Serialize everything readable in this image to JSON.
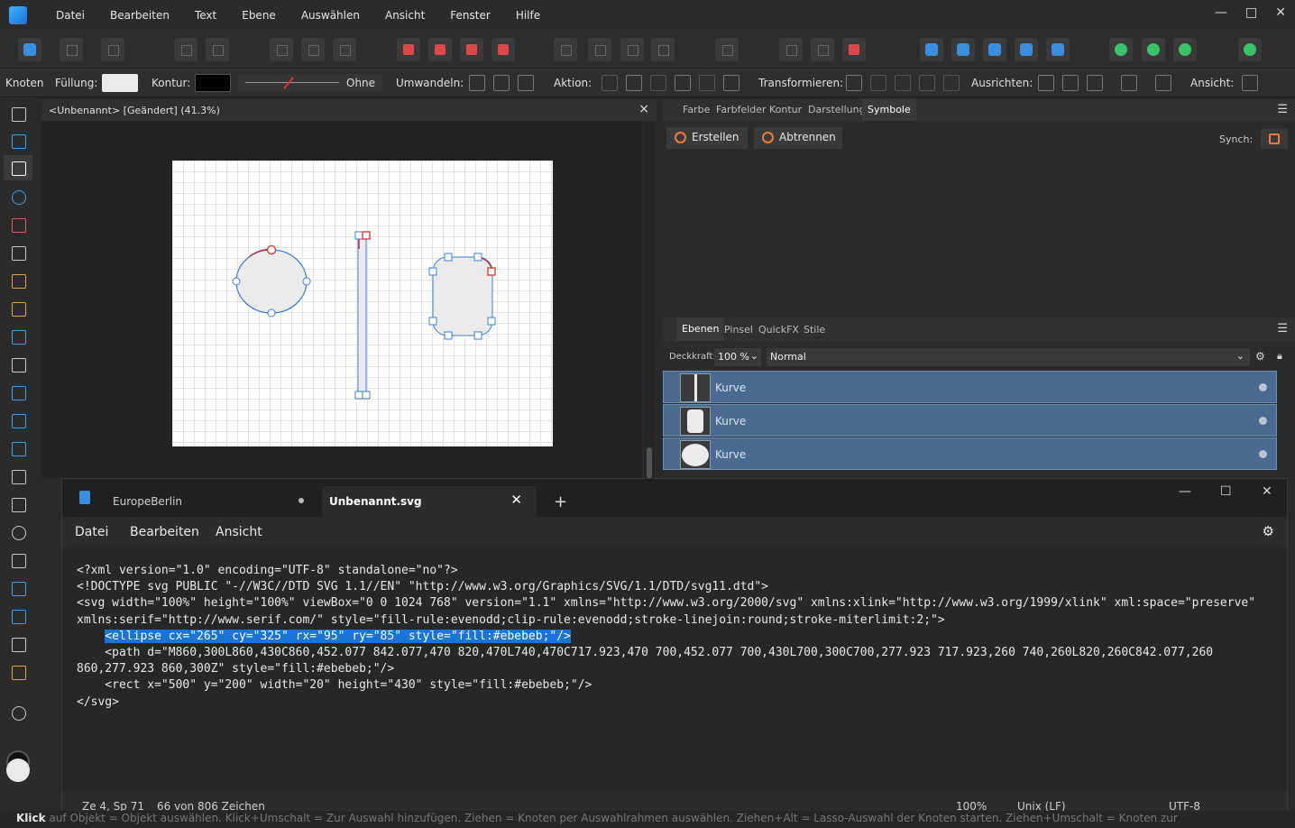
{
  "menubar": {
    "items": [
      "Datei",
      "Bearbeiten",
      "Text",
      "Ebene",
      "Auswählen",
      "Ansicht",
      "Fenster",
      "Hilfe"
    ],
    "window_controls": [
      "—",
      "□",
      "✕"
    ]
  },
  "context_bar": {
    "mode": "Knoten",
    "fill_label": "Füllung:",
    "fill_color": "#ebebeb",
    "stroke_label": "Kontur:",
    "stroke_color": "#000000",
    "stroke_style": "Ohne",
    "convert_label": "Umwandeln:",
    "action_label": "Aktion:",
    "transform_label": "Transformieren:",
    "align_label": "Ausrichten:",
    "view_label": "Ansicht:"
  },
  "document": {
    "tab_title": "<Unbenannt> [Geändert] (41.3%)",
    "close": "×"
  },
  "panel_top": {
    "tabs": [
      "Farbe",
      "Farbfelder",
      "Kontur",
      "Darstellung",
      "Symbole"
    ],
    "active_tab": "Symbole",
    "buttons": [
      "Erstellen",
      "Abtrennen"
    ],
    "sync_label": "Synch:"
  },
  "layers_panel": {
    "tabs": [
      "Ebenen",
      "Pinsel",
      "QuickFX",
      "Stile"
    ],
    "active_tab": "Ebenen",
    "opacity_label": "Deckkraft:",
    "opacity_value": "100 %",
    "blend_mode": "Normal",
    "layers": [
      {
        "name": "Kurve",
        "thumb": "rect"
      },
      {
        "name": "Kurve",
        "thumb": "rounded"
      },
      {
        "name": "Kurve",
        "thumb": "ellipse"
      }
    ]
  },
  "notepad": {
    "tab1": "EuropeBerlin",
    "tab2": "Unbenannt.svg",
    "new_tab": "+",
    "menu": [
      "Datei",
      "Bearbeiten",
      "Ansicht"
    ],
    "lines": [
      "<?xml version=\"1.0\" encoding=\"UTF-8\" standalone=\"no\"?>",
      "<!DOCTYPE svg PUBLIC \"-//W3C//DTD SVG 1.1//EN\" \"http://www.w3.org/Graphics/SVG/1.1/DTD/svg11.dtd\">",
      "<svg width=\"100%\" height=\"100%\" viewBox=\"0 0 1024 768\" version=\"1.1\" xmlns=\"http://www.w3.org/2000/svg\" xmlns:xlink=\"http://www.w3.org/1999/xlink\" xml:space=\"preserve\"",
      "xmlns:serif=\"http://www.serif.com/\" style=\"fill-rule:evenodd;clip-rule:evenodd;stroke-linejoin:round;stroke-miterlimit:2;\">",
      "<ellipse cx=\"265\" cy=\"325\" rx=\"95\" ry=\"85\" style=\"fill:#ebebeb;\"/>",
      "    <path d=\"M860,300L860,430C860,452.077 842.077,470 820,470L740,470C717.923,470 700,452.077 700,430L700,300C700,277.923 717.923,260 740,260L820,260C842.077,260",
      "860,277.923 860,300Z\" style=\"fill:#ebebeb;\"/>",
      "    <rect x=\"500\" y=\"200\" width=\"20\" height=\"430\" style=\"fill:#ebebeb;\"/>",
      "</svg>"
    ],
    "status": {
      "position": "Ze 4, Sp 71",
      "chars": "66 von 806 Zeichen",
      "zoom": "100%",
      "eol": "Unix (LF)",
      "encoding": "UTF-8"
    }
  },
  "hint": {
    "prefix": "Klick",
    "rest": " auf Objekt = Objekt auswählen. Klick+Umschalt = Zur Auswahl hinzufügen. Ziehen = Knoten per Auswahlrahmen auswählen. Ziehen+Alt = Lasso-Auswahl der Knoten starten. Ziehen+Umschalt = Knoten zur"
  }
}
